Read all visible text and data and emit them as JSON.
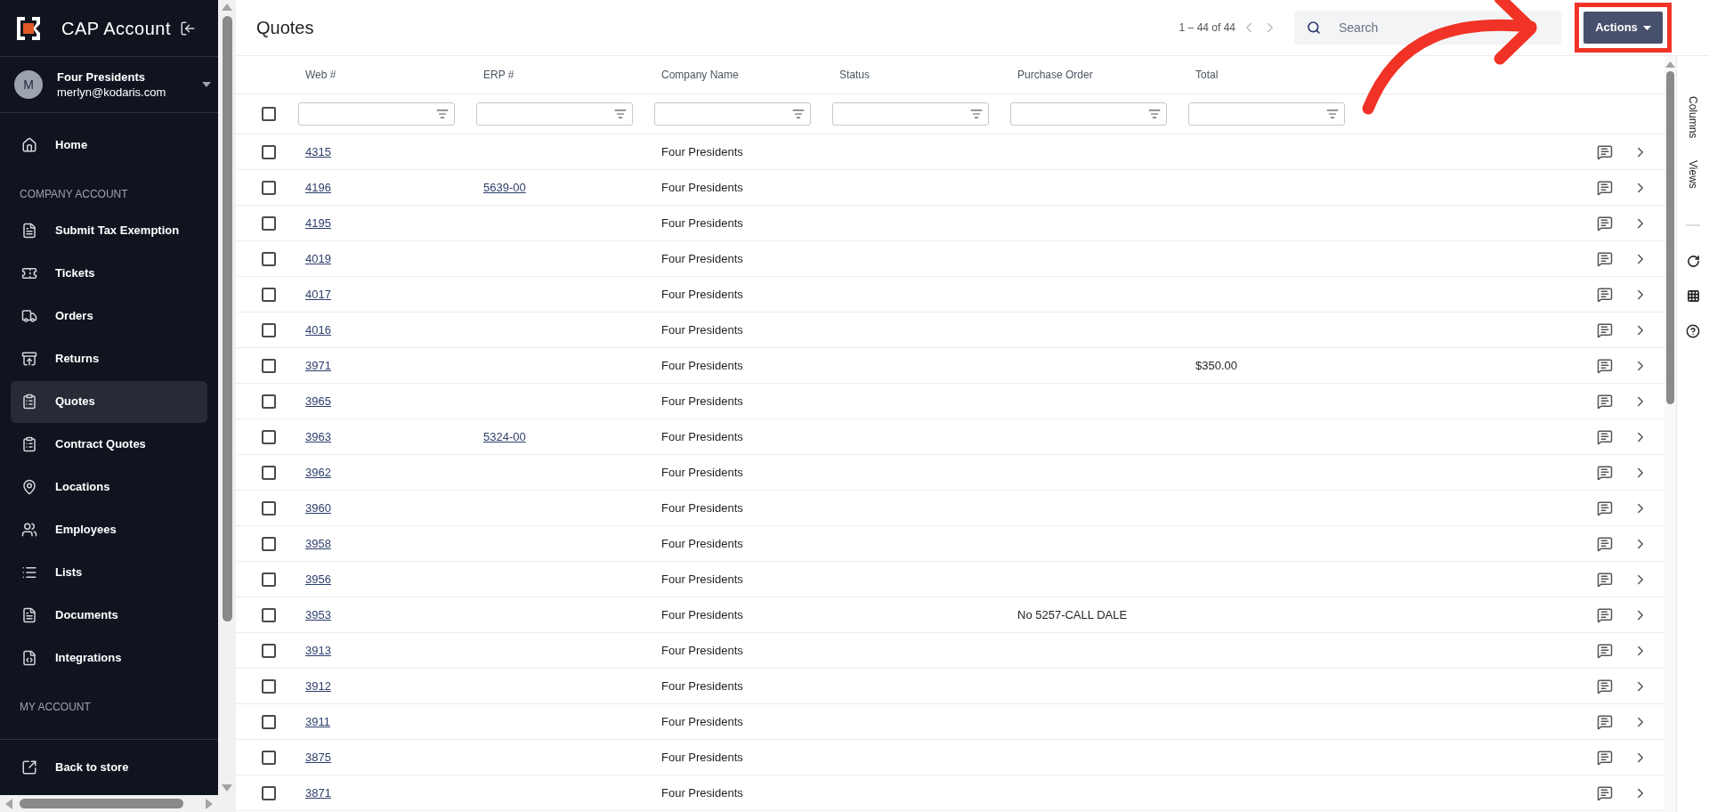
{
  "app": {
    "title": "CAP Account"
  },
  "user": {
    "initial": "M",
    "company": "Four Presidents",
    "email": "merlyn@kodaris.com"
  },
  "sidebar": {
    "items": [
      {
        "kind": "link",
        "label": "Home",
        "selected": false
      },
      {
        "kind": "section",
        "label": "COMPANY ACCOUNT"
      },
      {
        "kind": "link",
        "label": "Submit Tax Exemption",
        "selected": false
      },
      {
        "kind": "link",
        "label": "Tickets",
        "selected": false
      },
      {
        "kind": "link",
        "label": "Orders",
        "selected": false
      },
      {
        "kind": "link",
        "label": "Returns",
        "selected": false
      },
      {
        "kind": "link",
        "label": "Quotes",
        "selected": true
      },
      {
        "kind": "link",
        "label": "Contract Quotes",
        "selected": false
      },
      {
        "kind": "link",
        "label": "Locations",
        "selected": false
      },
      {
        "kind": "link",
        "label": "Employees",
        "selected": false
      },
      {
        "kind": "link",
        "label": "Lists",
        "selected": false
      },
      {
        "kind": "link",
        "label": "Documents",
        "selected": false
      },
      {
        "kind": "link",
        "label": "Integrations",
        "selected": false
      },
      {
        "kind": "section",
        "label": "MY ACCOUNT"
      }
    ],
    "footer": {
      "label": "Back to store"
    }
  },
  "page": {
    "title": "Quotes",
    "pagination": "1 – 44 of 44",
    "search": {
      "placeholder": "Search"
    },
    "actions": "Actions"
  },
  "side_panel": {
    "tabs": [
      "Columns",
      "Views"
    ]
  },
  "table": {
    "select_all": {
      "checked": false
    },
    "columns": [
      "Web #",
      "ERP #",
      "Company Name",
      "Status",
      "Purchase Order",
      "Total"
    ],
    "rows": [
      {
        "checked": false,
        "cells": [
          "4315",
          "",
          "Four Presidents",
          "",
          "",
          ""
        ]
      },
      {
        "checked": false,
        "cells": [
          "4196",
          "5639-00",
          "Four Presidents",
          "",
          "",
          ""
        ]
      },
      {
        "checked": false,
        "cells": [
          "4195",
          "",
          "Four Presidents",
          "",
          "",
          ""
        ]
      },
      {
        "checked": false,
        "cells": [
          "4019",
          "",
          "Four Presidents",
          "",
          "",
          ""
        ]
      },
      {
        "checked": false,
        "cells": [
          "4017",
          "",
          "Four Presidents",
          "",
          "",
          ""
        ]
      },
      {
        "checked": false,
        "cells": [
          "4016",
          "",
          "Four Presidents",
          "",
          "",
          ""
        ]
      },
      {
        "checked": false,
        "cells": [
          "3971",
          "",
          "Four Presidents",
          "",
          "",
          "$350.00"
        ]
      },
      {
        "checked": false,
        "cells": [
          "3965",
          "",
          "Four Presidents",
          "",
          "",
          ""
        ]
      },
      {
        "checked": false,
        "cells": [
          "3963",
          "5324-00",
          "Four Presidents",
          "",
          "",
          ""
        ]
      },
      {
        "checked": false,
        "cells": [
          "3962",
          "",
          "Four Presidents",
          "",
          "",
          ""
        ]
      },
      {
        "checked": false,
        "cells": [
          "3960",
          "",
          "Four Presidents",
          "",
          "",
          ""
        ]
      },
      {
        "checked": false,
        "cells": [
          "3958",
          "",
          "Four Presidents",
          "",
          "",
          ""
        ]
      },
      {
        "checked": false,
        "cells": [
          "3956",
          "",
          "Four Presidents",
          "",
          "",
          ""
        ]
      },
      {
        "checked": false,
        "cells": [
          "3953",
          "",
          "Four Presidents",
          "",
          "No 5257-CALL DALE",
          ""
        ]
      },
      {
        "checked": false,
        "cells": [
          "3913",
          "",
          "Four Presidents",
          "",
          "",
          ""
        ]
      },
      {
        "checked": false,
        "cells": [
          "3912",
          "",
          "Four Presidents",
          "",
          "",
          ""
        ]
      },
      {
        "checked": false,
        "cells": [
          "3911",
          "",
          "Four Presidents",
          "",
          "",
          ""
        ]
      },
      {
        "checked": false,
        "cells": [
          "3875",
          "",
          "Four Presidents",
          "",
          "",
          ""
        ]
      },
      {
        "checked": false,
        "cells": [
          "3871",
          "",
          "Four Presidents",
          "",
          "",
          ""
        ]
      }
    ]
  }
}
